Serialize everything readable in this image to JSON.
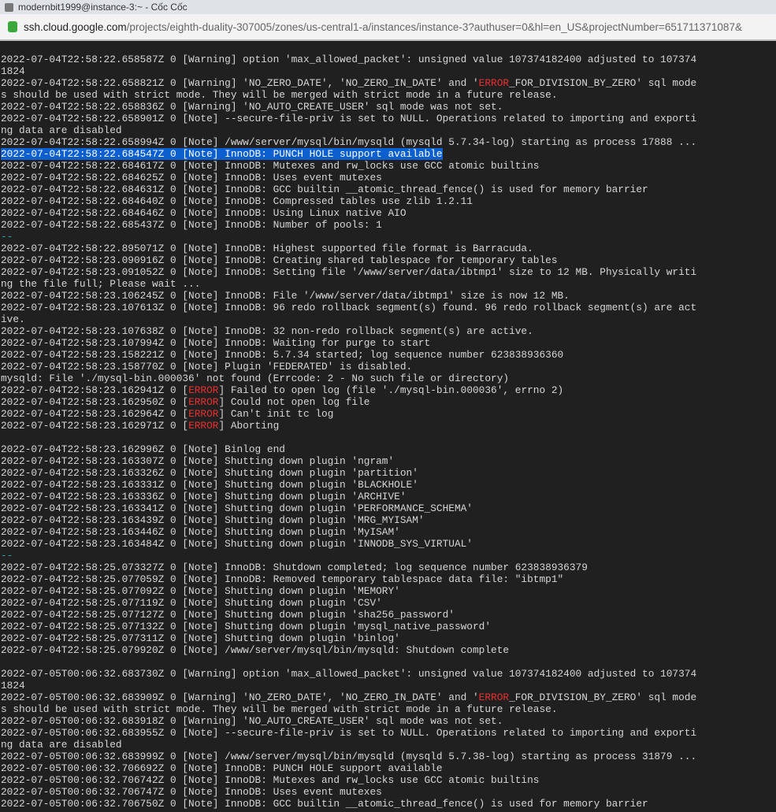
{
  "window": {
    "title": "modernbit1999@instance-3:~ - Cốc Cốc"
  },
  "address": {
    "host": "ssh.cloud.google.com",
    "path": "/projects/eighth-duality-307005/zones/us-central1-a/instances/instance-3?authuser=0&hl=en_US&projectNumber=651711371087&"
  },
  "terminal": {
    "lines": [
      [
        [
          "2022-07-04T22:58:22.658587Z 0 [Warning] option 'max_allowed_packet': unsigned value 107374182400 adjusted to 107374",
          ""
        ]
      ],
      [
        [
          "1824",
          ""
        ]
      ],
      [
        [
          "2022-07-04T22:58:22.658821Z 0 [Warning] 'NO_ZERO_DATE', 'NO_ZERO_IN_DATE' and '",
          ""
        ],
        [
          "ERROR",
          "err"
        ],
        [
          "_FOR_DIVISION_BY_ZERO' sql mode",
          ""
        ]
      ],
      [
        [
          "s should be used with strict mode. They will be merged with strict mode in a future release.",
          ""
        ]
      ],
      [
        [
          "2022-07-04T22:58:22.658836Z 0 [Warning] 'NO_AUTO_CREATE_USER' sql mode was not set.",
          ""
        ]
      ],
      [
        [
          "2022-07-04T22:58:22.658901Z 0 [Note] --secure-file-priv is set to NULL. Operations related to importing and exporti",
          ""
        ]
      ],
      [
        [
          "ng data are disabled",
          ""
        ]
      ],
      [
        [
          "2022-07-04T22:58:22.658994Z 0 [Note] /www/server/mysql/bin/mysqld (mysqld 5.7.34-log) starting as process 17888 ...",
          ""
        ]
      ],
      [
        [
          "2022-07-04T22:58:22.684547Z 0 [Note] InnoDB: PUNCH HOLE support available",
          "sel"
        ]
      ],
      [
        [
          "2022-07-04T22:58:22.684617Z 0 [Note] InnoDB: Mutexes and rw_locks use GCC atomic builtins",
          ""
        ]
      ],
      [
        [
          "2022-07-04T22:58:22.684625Z 0 [Note] InnoDB: Uses event mutexes",
          ""
        ]
      ],
      [
        [
          "2022-07-04T22:58:22.684631Z 0 [Note] InnoDB: GCC builtin __atomic_thread_fence() is used for memory barrier",
          ""
        ]
      ],
      [
        [
          "2022-07-04T22:58:22.684640Z 0 [Note] InnoDB: Compressed tables use zlib 1.2.11",
          ""
        ]
      ],
      [
        [
          "2022-07-04T22:58:22.684646Z 0 [Note] InnoDB: Using Linux native AIO",
          ""
        ]
      ],
      [
        [
          "2022-07-04T22:58:22.685437Z 0 [Note] InnoDB: Number of pools: 1",
          ""
        ]
      ],
      [
        [
          "--",
          "dash"
        ]
      ],
      [
        [
          "2022-07-04T22:58:22.895071Z 0 [Note] InnoDB: Highest supported file format is Barracuda.",
          ""
        ]
      ],
      [
        [
          "2022-07-04T22:58:23.090916Z 0 [Note] InnoDB: Creating shared tablespace for temporary tables",
          ""
        ]
      ],
      [
        [
          "2022-07-04T22:58:23.091052Z 0 [Note] InnoDB: Setting file '/www/server/data/ibtmp1' size to 12 MB. Physically writi",
          ""
        ]
      ],
      [
        [
          "ng the file full; Please wait ...",
          ""
        ]
      ],
      [
        [
          "2022-07-04T22:58:23.106245Z 0 [Note] InnoDB: File '/www/server/data/ibtmp1' size is now 12 MB.",
          ""
        ]
      ],
      [
        [
          "2022-07-04T22:58:23.107613Z 0 [Note] InnoDB: 96 redo rollback segment(s) found. 96 redo rollback segment(s) are act",
          ""
        ]
      ],
      [
        [
          "ive.",
          ""
        ]
      ],
      [
        [
          "2022-07-04T22:58:23.107638Z 0 [Note] InnoDB: 32 non-redo rollback segment(s) are active.",
          ""
        ]
      ],
      [
        [
          "2022-07-04T22:58:23.107994Z 0 [Note] InnoDB: Waiting for purge to start",
          ""
        ]
      ],
      [
        [
          "2022-07-04T22:58:23.158221Z 0 [Note] InnoDB: 5.7.34 started; log sequence number 623838936360",
          ""
        ]
      ],
      [
        [
          "2022-07-04T22:58:23.158770Z 0 [Note] Plugin 'FEDERATED' is disabled.",
          ""
        ]
      ],
      [
        [
          "mysqld: File './mysql-bin.000036' not found (Errcode: 2 - No such file or directory)",
          ""
        ]
      ],
      [
        [
          "2022-07-04T22:58:23.162941Z 0 [",
          ""
        ],
        [
          "ERROR",
          "err"
        ],
        [
          "] Failed to open log (file './mysql-bin.000036', errno 2)",
          ""
        ]
      ],
      [
        [
          "2022-07-04T22:58:23.162950Z 0 [",
          ""
        ],
        [
          "ERROR",
          "err"
        ],
        [
          "] Could not open log file",
          ""
        ]
      ],
      [
        [
          "2022-07-04T22:58:23.162964Z 0 [",
          ""
        ],
        [
          "ERROR",
          "err"
        ],
        [
          "] Can't init tc log",
          ""
        ]
      ],
      [
        [
          "2022-07-04T22:58:23.162971Z 0 [",
          ""
        ],
        [
          "ERROR",
          "err"
        ],
        [
          "] Aborting",
          ""
        ]
      ],
      [
        [
          "",
          ""
        ]
      ],
      [
        [
          "2022-07-04T22:58:23.162996Z 0 [Note] Binlog end",
          ""
        ]
      ],
      [
        [
          "2022-07-04T22:58:23.163307Z 0 [Note] Shutting down plugin 'ngram'",
          ""
        ]
      ],
      [
        [
          "2022-07-04T22:58:23.163326Z 0 [Note] Shutting down plugin 'partition'",
          ""
        ]
      ],
      [
        [
          "2022-07-04T22:58:23.163331Z 0 [Note] Shutting down plugin 'BLACKHOLE'",
          ""
        ]
      ],
      [
        [
          "2022-07-04T22:58:23.163336Z 0 [Note] Shutting down plugin 'ARCHIVE'",
          ""
        ]
      ],
      [
        [
          "2022-07-04T22:58:23.163341Z 0 [Note] Shutting down plugin 'PERFORMANCE_SCHEMA'",
          ""
        ]
      ],
      [
        [
          "2022-07-04T22:58:23.163439Z 0 [Note] Shutting down plugin 'MRG_MYISAM'",
          ""
        ]
      ],
      [
        [
          "2022-07-04T22:58:23.163446Z 0 [Note] Shutting down plugin 'MyISAM'",
          ""
        ]
      ],
      [
        [
          "2022-07-04T22:58:23.163484Z 0 [Note] Shutting down plugin 'INNODB_SYS_VIRTUAL'",
          ""
        ]
      ],
      [
        [
          "--",
          "dash"
        ]
      ],
      [
        [
          "2022-07-04T22:58:25.073327Z 0 [Note] InnoDB: Shutdown completed; log sequence number 623838936379",
          ""
        ]
      ],
      [
        [
          "2022-07-04T22:58:25.077059Z 0 [Note] InnoDB: Removed temporary tablespace data file: \"ibtmp1\"",
          ""
        ]
      ],
      [
        [
          "2022-07-04T22:58:25.077092Z 0 [Note] Shutting down plugin 'MEMORY'",
          ""
        ]
      ],
      [
        [
          "2022-07-04T22:58:25.077119Z 0 [Note] Shutting down plugin 'CSV'",
          ""
        ]
      ],
      [
        [
          "2022-07-04T22:58:25.077127Z 0 [Note] Shutting down plugin 'sha256_password'",
          ""
        ]
      ],
      [
        [
          "2022-07-04T22:58:25.077132Z 0 [Note] Shutting down plugin 'mysql_native_password'",
          ""
        ]
      ],
      [
        [
          "2022-07-04T22:58:25.077311Z 0 [Note] Shutting down plugin 'binlog'",
          ""
        ]
      ],
      [
        [
          "2022-07-04T22:58:25.079920Z 0 [Note] /www/server/mysql/bin/mysqld: Shutdown complete",
          ""
        ]
      ],
      [
        [
          "",
          ""
        ]
      ],
      [
        [
          "2022-07-05T00:06:32.683730Z 0 [Warning] option 'max_allowed_packet': unsigned value 107374182400 adjusted to 107374",
          ""
        ]
      ],
      [
        [
          "1824",
          ""
        ]
      ],
      [
        [
          "2022-07-05T00:06:32.683909Z 0 [Warning] 'NO_ZERO_DATE', 'NO_ZERO_IN_DATE' and '",
          ""
        ],
        [
          "ERROR",
          "err"
        ],
        [
          "_FOR_DIVISION_BY_ZERO' sql mode",
          ""
        ]
      ],
      [
        [
          "s should be used with strict mode. They will be merged with strict mode in a future release.",
          ""
        ]
      ],
      [
        [
          "2022-07-05T00:06:32.683918Z 0 [Warning] 'NO_AUTO_CREATE_USER' sql mode was not set.",
          ""
        ]
      ],
      [
        [
          "2022-07-05T00:06:32.683955Z 0 [Note] --secure-file-priv is set to NULL. Operations related to importing and exporti",
          ""
        ]
      ],
      [
        [
          "ng data are disabled",
          ""
        ]
      ],
      [
        [
          "2022-07-05T00:06:32.683999Z 0 [Note] /www/server/mysql/bin/mysqld (mysqld 5.7.38-log) starting as process 31879 ...",
          ""
        ]
      ],
      [
        [
          "2022-07-05T00:06:32.706692Z 0 [Note] InnoDB: PUNCH HOLE support available",
          ""
        ]
      ],
      [
        [
          "2022-07-05T00:06:32.706742Z 0 [Note] InnoDB: Mutexes and rw_locks use GCC atomic builtins",
          ""
        ]
      ],
      [
        [
          "2022-07-05T00:06:32.706747Z 0 [Note] InnoDB: Uses event mutexes",
          ""
        ]
      ],
      [
        [
          "2022-07-05T00:06:32.706750Z 0 [Note] InnoDB: GCC builtin __atomic_thread_fence() is used for memory barrier",
          ""
        ]
      ]
    ]
  }
}
